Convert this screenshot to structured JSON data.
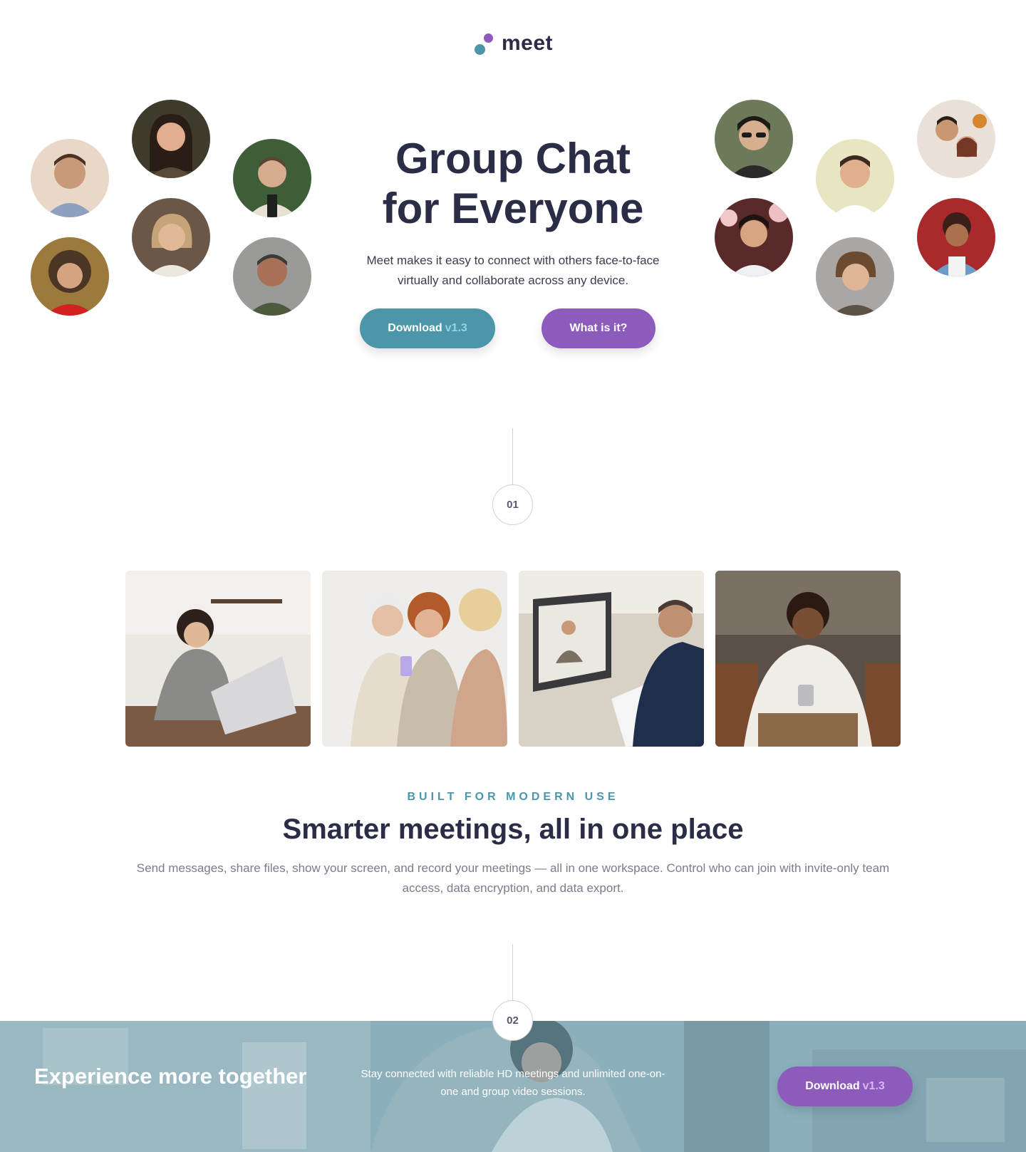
{
  "brand": {
    "name": "meet",
    "teal": "#4d96a9",
    "purple": "#8d5bbc",
    "navy": "#2b2d47"
  },
  "hero": {
    "title_line1": "Group Chat",
    "title_line2": "for Everyone",
    "subtitle": "Meet makes it easy to connect with others face-to-face virtually and collaborate across any device.",
    "download_label": "Download",
    "download_version": "v1.3",
    "what_label": "What is it?"
  },
  "steps": {
    "first": "01",
    "second": "02"
  },
  "features": {
    "eyebrow": "BUILT FOR MODERN USE",
    "title": "Smarter meetings, all in one place",
    "text": "Send messages, share files, show your screen, and record your meetings — all in one workspace. Control who can join with invite-only team access, data encryption, and data export."
  },
  "banner": {
    "title": "Experience more together",
    "text": "Stay connected with reliable HD meetings and unlimited one-on-one and group video sessions.",
    "download_label": "Download",
    "download_version": "v1.3"
  }
}
